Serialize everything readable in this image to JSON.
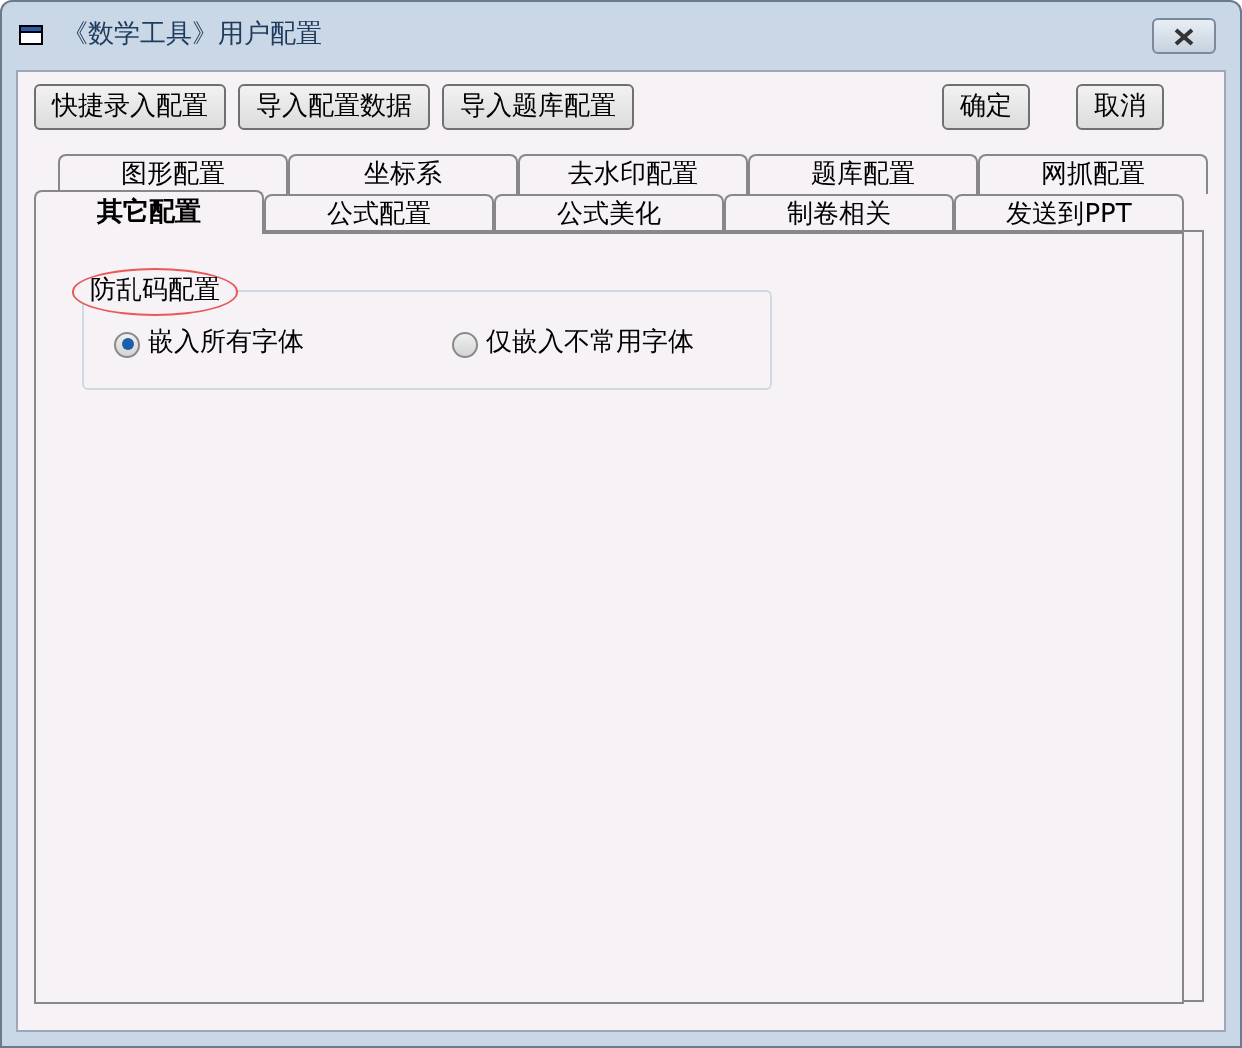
{
  "window": {
    "title": "《数学工具》用户配置"
  },
  "toolbar": {
    "left_buttons": [
      "快捷录入配置",
      "导入配置数据",
      "导入题库配置"
    ],
    "right_buttons": [
      "确定",
      "取消"
    ]
  },
  "tab_rows": [
    {
      "tabs": [
        {
          "label": "图形配置",
          "selected": false
        },
        {
          "label": "坐标系",
          "selected": false
        },
        {
          "label": "去水印配置",
          "selected": false
        },
        {
          "label": "题库配置",
          "selected": false
        },
        {
          "label": "网抓配置",
          "selected": false
        }
      ]
    },
    {
      "tabs": [
        {
          "label": "其它配置",
          "selected": true
        },
        {
          "label": "公式配置",
          "selected": false
        },
        {
          "label": "公式美化",
          "selected": false
        },
        {
          "label": "制卷相关",
          "selected": false
        },
        {
          "label": "发送到PPT",
          "selected": false
        }
      ]
    }
  ],
  "group": {
    "title": "防乱码配置",
    "options": [
      {
        "label": "嵌入所有字体",
        "selected": true
      },
      {
        "label": "仅嵌入不常用字体",
        "selected": false
      }
    ]
  }
}
